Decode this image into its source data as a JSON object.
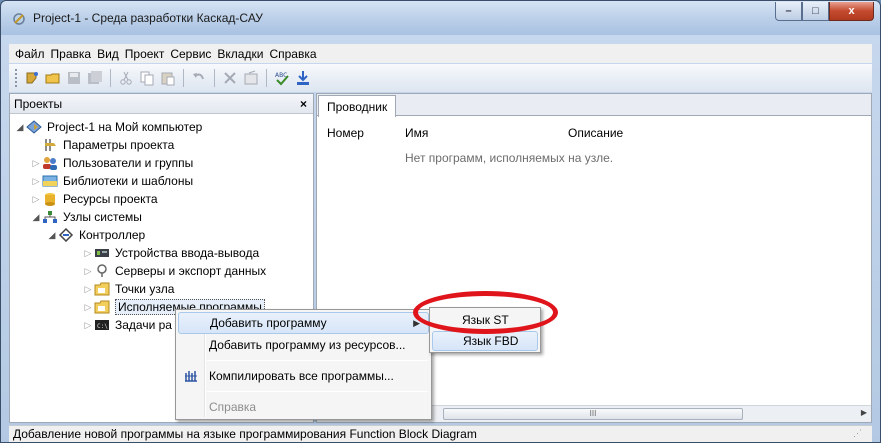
{
  "window": {
    "title": "Project-1 - Среда разработки Каскад-САУ",
    "minimize": "–",
    "maximize": "□",
    "close": "x"
  },
  "menu": [
    {
      "label": "Файл"
    },
    {
      "label": "Правка"
    },
    {
      "label": "Вид"
    },
    {
      "label": "Проект"
    },
    {
      "label": "Сервис"
    },
    {
      "label": "Вкладки"
    },
    {
      "label": "Справка"
    }
  ],
  "toolbar": {
    "icons": [
      "new-icon",
      "open-icon",
      "save-icon",
      "save-all-icon",
      "cut-icon",
      "copy-icon",
      "paste-icon",
      "undo-icon",
      "delete-icon",
      "properties-icon",
      "spellcheck-icon",
      "download-icon"
    ]
  },
  "left_panel": {
    "title": "Проекты",
    "close": "×",
    "tree": [
      {
        "label": "Project-1 на Мой компьютер",
        "level": 0,
        "state": "expanded",
        "icon": "project-icon"
      },
      {
        "label": "Параметры проекта",
        "level": 1,
        "state": "none",
        "icon": "parameters-icon"
      },
      {
        "label": "Пользователи и группы",
        "level": 1,
        "state": "collapsed",
        "icon": "users-icon"
      },
      {
        "label": "Библиотеки и шаблоны",
        "level": 1,
        "state": "collapsed",
        "icon": "library-icon"
      },
      {
        "label": "Ресурсы проекта",
        "level": 1,
        "state": "collapsed",
        "icon": "resources-icon"
      },
      {
        "label": "Узлы системы",
        "level": 1,
        "state": "expanded",
        "icon": "nodes-icon"
      },
      {
        "label": "Контроллер",
        "level": 2,
        "state": "expanded",
        "icon": "controller-icon"
      },
      {
        "label": "Устройства ввода-вывода",
        "level": 3,
        "state": "collapsed",
        "icon": "io-device-icon"
      },
      {
        "label": "Серверы и экспорт данных",
        "level": 3,
        "state": "collapsed",
        "icon": "server-icon"
      },
      {
        "label": "Точки узла",
        "level": 3,
        "state": "collapsed",
        "icon": "points-folder-icon"
      },
      {
        "label": "Исполняемые программы",
        "level": 3,
        "state": "collapsed",
        "icon": "programs-folder-icon",
        "selected": true
      },
      {
        "label": "Задачи ра",
        "level": 3,
        "state": "collapsed",
        "icon": "tasks-icon"
      }
    ]
  },
  "right_panel": {
    "tab": "Проводник",
    "columns": [
      "Номер",
      "Имя",
      "Описание"
    ],
    "empty_message": "Нет программ, исполняемых на узле.",
    "scroll_thumb": "III"
  },
  "context_menu": {
    "items": [
      {
        "label": "Добавить программу",
        "has_submenu": true,
        "state": "hover"
      },
      {
        "label": "Добавить программу из ресурсов...",
        "has_submenu": false,
        "state": "normal"
      },
      {
        "label": "Компилировать все программы...",
        "has_submenu": false,
        "state": "normal",
        "icon": "compile-icon"
      },
      {
        "label": "Справка",
        "has_submenu": false,
        "state": "disabled"
      }
    ]
  },
  "submenu": {
    "items": [
      {
        "label": "Язык ST",
        "state": "normal"
      },
      {
        "label": "Язык FBD",
        "state": "hover"
      }
    ]
  },
  "annotation": {
    "color": "#e0141b",
    "shape": "ellipse",
    "target": "Язык ST"
  },
  "status_bar": {
    "text": "Добавление новой программы на языке программирования Function Block Diagram"
  }
}
